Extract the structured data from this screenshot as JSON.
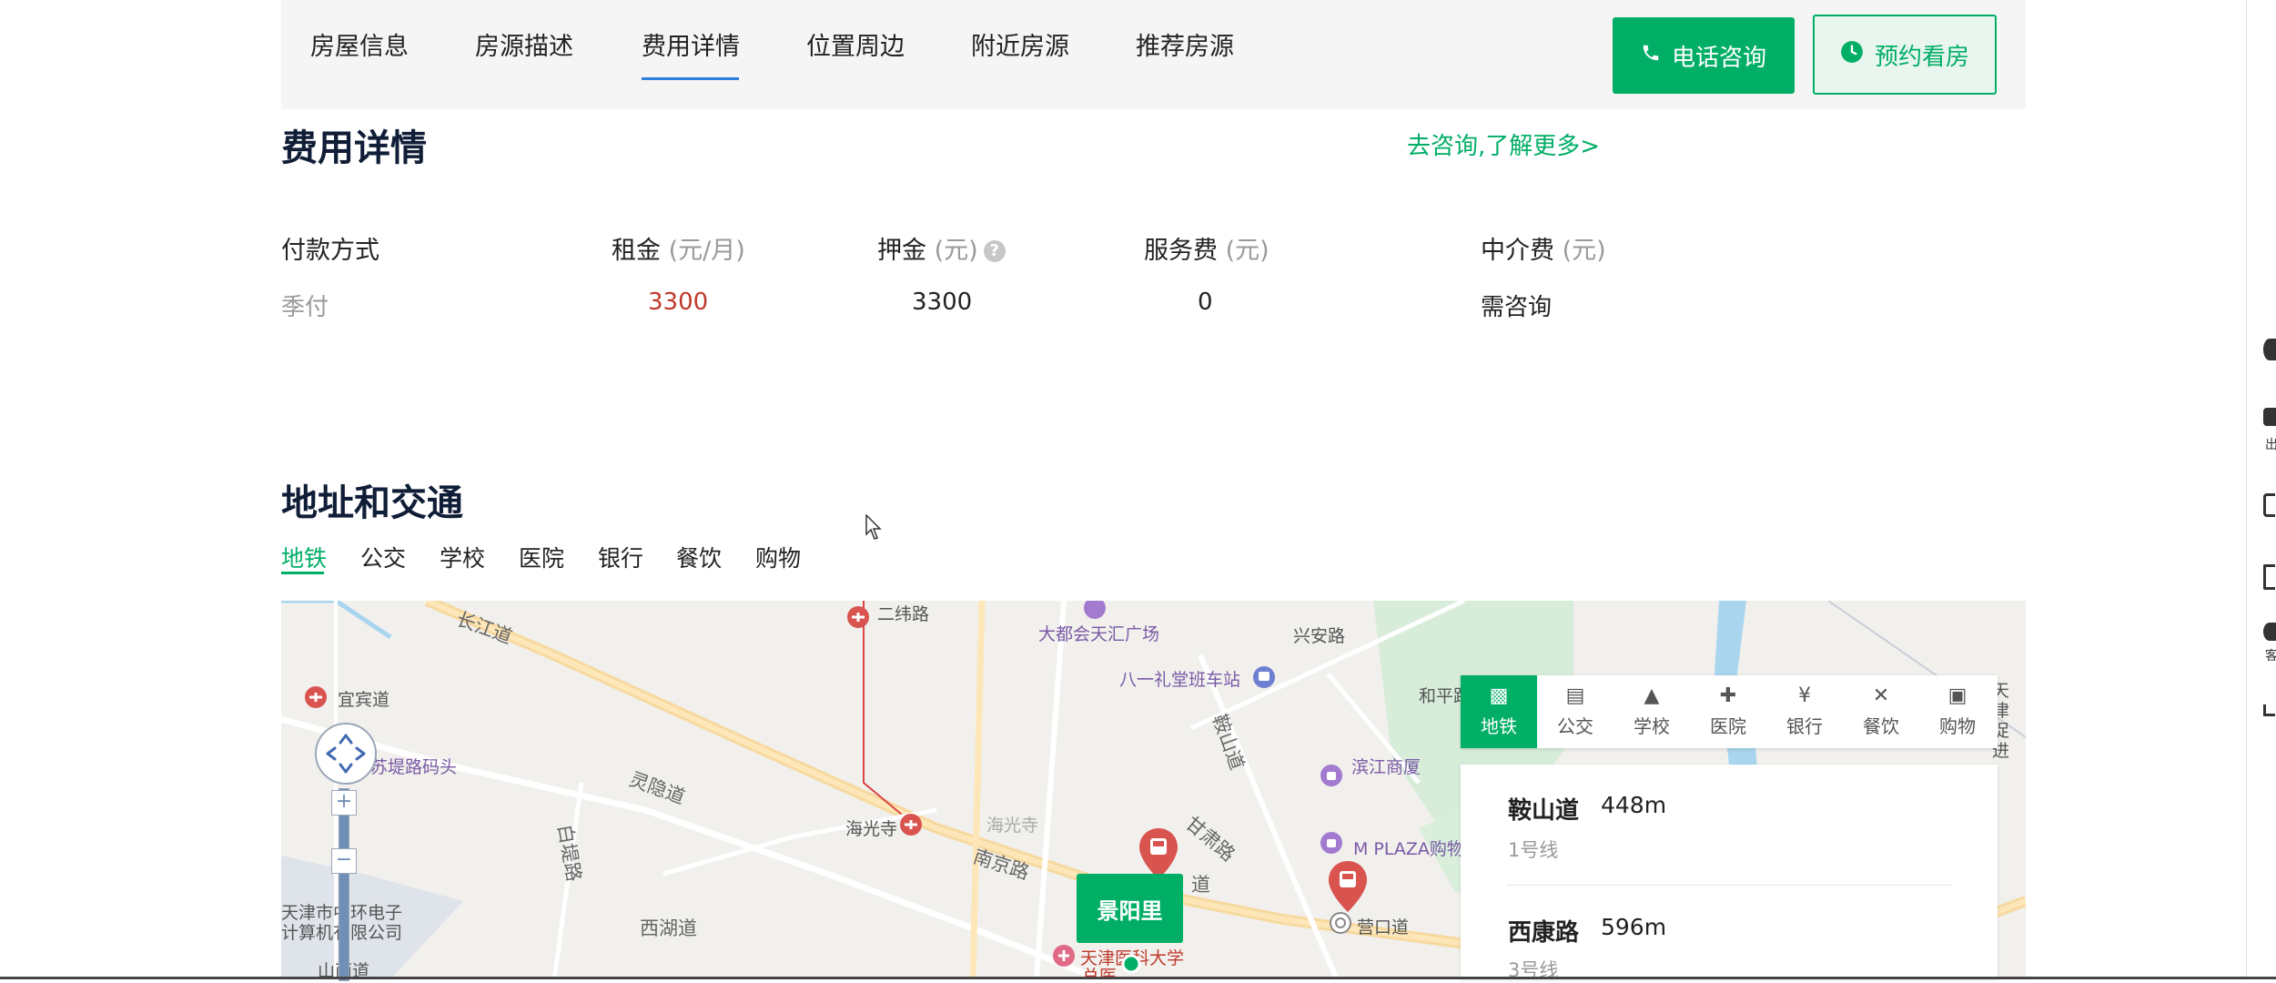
{
  "nav": {
    "tabs": [
      "房屋信息",
      "房源描述",
      "费用详情",
      "位置周边",
      "附近房源",
      "推荐房源"
    ],
    "active_tab": "费用详情",
    "call_button": "电话咨询",
    "book_button": "预约看房"
  },
  "fees": {
    "title": "费用详情",
    "more_link": "去咨询,了解更多>",
    "headers": [
      {
        "label": "付款方式",
        "unit": ""
      },
      {
        "label": "租金",
        "unit": "(元/月)"
      },
      {
        "label": "押金",
        "unit": "(元)"
      },
      {
        "label": "服务费",
        "unit": "(元)"
      },
      {
        "label": "中介费",
        "unit": "(元)"
      }
    ],
    "values": [
      "季付",
      "3300",
      "3300",
      "0",
      "需咨询"
    ]
  },
  "location": {
    "title": "地址和交通",
    "tabs": [
      "地铁",
      "公交",
      "学校",
      "医院",
      "银行",
      "餐饮",
      "购物"
    ],
    "active_tab": "地铁"
  },
  "map": {
    "labels": {
      "changjiang": "长江道",
      "erwei": "二纬路",
      "dadu": "大都会天汇广场",
      "xingan": "兴安路",
      "bayi": "八一礼堂班车站",
      "heping": "和平路",
      "yibin": "宜宾道",
      "sudi": "苏堤路码头",
      "lingyin": "灵隐道",
      "baiti": "白堤路",
      "haiguangsi_station": "海光寺",
      "haiguangsi": "海光寺",
      "anshan_road": "鞍山道",
      "binjiang": "滨江商厦",
      "nanjing": "南京路",
      "gankang": "甘肃路",
      "mplaza": "M PLAZA购物广",
      "xihu": "西湖道",
      "yingkou": "营口道",
      "tianjin_zhonghuan": "天津市中环电子计算机有限公司",
      "anshanxi": "山西道",
      "tianjin_medical": "天津医科大学",
      "zongyi": "总医",
      "tianjin_cu": "天津促进",
      "dao": "道"
    },
    "house_marker": "景阳里",
    "poi_panel": [
      "地铁",
      "公交",
      "学校",
      "医院",
      "银行",
      "餐饮",
      "购物"
    ],
    "stations": [
      {
        "name": "鞍山道",
        "distance": "448m",
        "line": "1号线"
      },
      {
        "name": "西康路",
        "distance": "596m",
        "line": "3号线"
      }
    ]
  },
  "sidebar": {
    "labels": [
      "出",
      "客"
    ]
  }
}
